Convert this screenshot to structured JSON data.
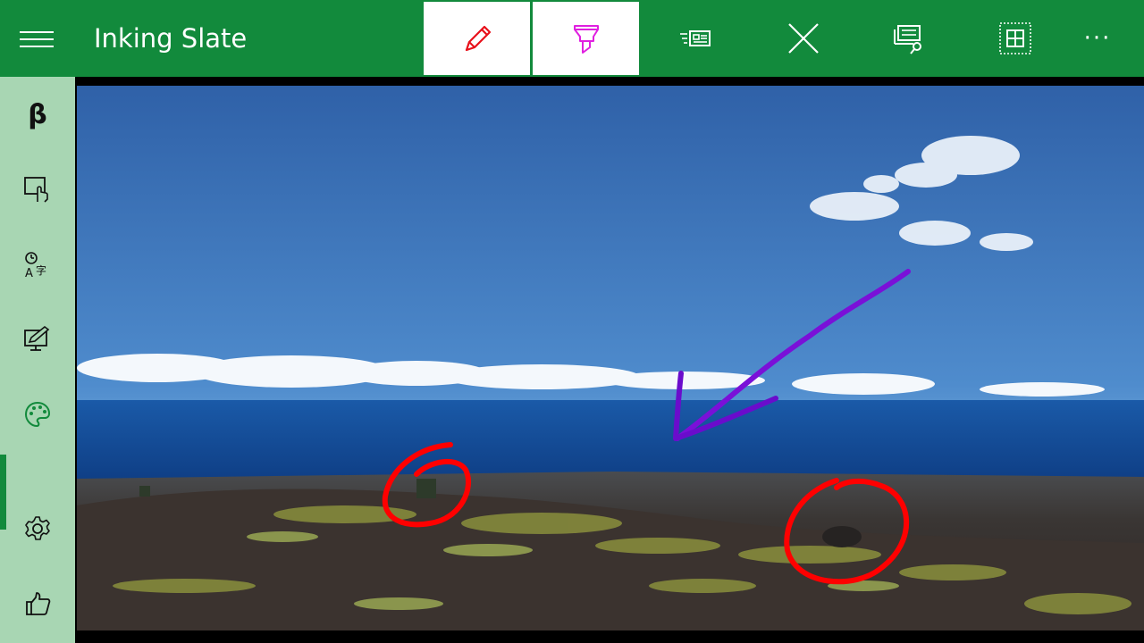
{
  "app": {
    "title": "Inking Slate"
  },
  "toolbar": {
    "menu": "hamburger-menu",
    "tools": [
      {
        "name": "pen-icon",
        "active": true
      },
      {
        "name": "highlighter-icon",
        "active": true
      },
      {
        "name": "newspaper-icon",
        "active": false
      },
      {
        "name": "close-icon",
        "active": false
      },
      {
        "name": "image-search-icon",
        "active": false
      },
      {
        "name": "select-grid-icon",
        "active": false
      },
      {
        "name": "more-icon",
        "active": false
      }
    ],
    "more_label": "···"
  },
  "sidebar": {
    "beta_label": "β",
    "items": [
      "beta-icon",
      "touch-screen-icon",
      "timer-text-icon",
      "draw-desktop-icon",
      "palette-icon",
      "settings-icon",
      "like-icon"
    ],
    "selected": "palette-icon"
  },
  "colors": {
    "brand": "#128a3c",
    "sidebar": "#a8d6b3",
    "pen": "#e8101a",
    "highlighter": "#e020e0",
    "ink_arrow": "#7a10d8",
    "ink_circle": "#ff0000"
  }
}
